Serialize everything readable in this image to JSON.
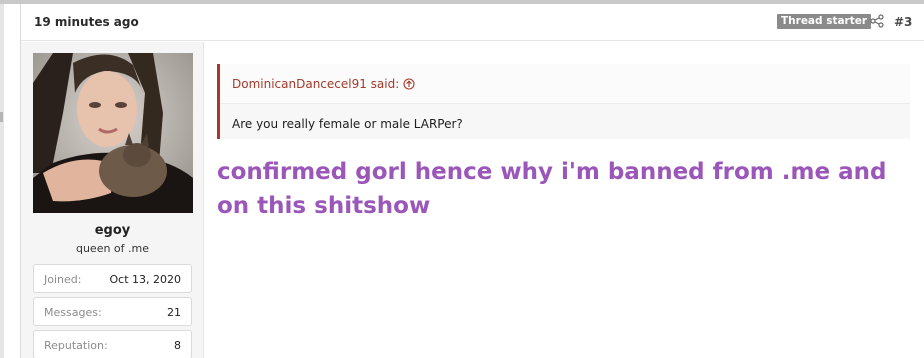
{
  "post": {
    "time": "19 minutes ago",
    "badge": "Thread starter",
    "number": "#3",
    "icons": {
      "share": "share-icon",
      "quote_link": "circle-arrow-up-icon"
    }
  },
  "user": {
    "name": "egoy",
    "title": "queen of .me",
    "stats": [
      {
        "label": "Joined:",
        "value": "Oct 13, 2020"
      },
      {
        "label": "Messages:",
        "value": "21"
      },
      {
        "label": "Reputation:",
        "value": "8"
      }
    ]
  },
  "quote": {
    "author": "DominicanDancecel91 said:",
    "text": "Are you really female or male LARPer?"
  },
  "message": {
    "text": "confirmed gorl hence why i'm banned from .me and on this shitshow",
    "color": "#9a56b8"
  },
  "colors": {
    "quote_accent": "#a33a2a",
    "badge": "#8a8a8a"
  }
}
